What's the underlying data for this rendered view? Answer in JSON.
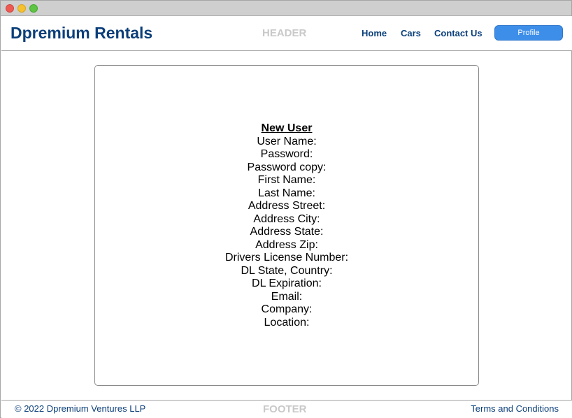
{
  "window": {
    "controls": [
      "close",
      "minimize",
      "maximize"
    ]
  },
  "header": {
    "brand": "Dpremium Rentals",
    "section_label": "HEADER",
    "nav": {
      "home": "Home",
      "cars": "Cars",
      "contact": "Contact Us"
    },
    "profile_button": "Profile"
  },
  "form": {
    "title": "New User",
    "fields": [
      "User Name:",
      "Password:",
      "Password copy:",
      "First Name:",
      "Last Name:",
      "Address Street:",
      "Address City:",
      "Address State:",
      "Address Zip:",
      "Drivers License Number:",
      "DL State, Country:",
      "DL Expiration:",
      "Email:",
      "Company:",
      "Location:"
    ]
  },
  "footer": {
    "copyright": "© 2022 Dpremium Ventures LLP",
    "section_label": "FOOTER",
    "terms_link": "Terms and Conditions"
  },
  "colors": {
    "brand": "#0b3f7a",
    "accent": "#3d8ee9",
    "placeholder_label": "#c9c9c9"
  }
}
